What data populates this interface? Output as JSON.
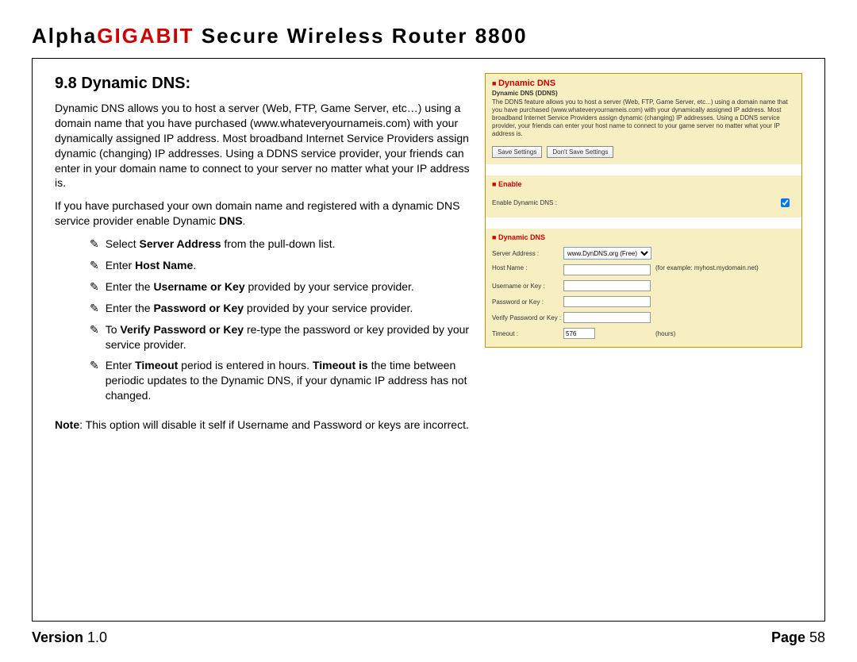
{
  "header": {
    "brand_prefix": "Alpha",
    "brand_red": "GIGABIT",
    "brand_rest": " Secure Wireless Router 8800"
  },
  "footer": {
    "version_label": "Version ",
    "version_value": "1.0",
    "page_label": "Page ",
    "page_number": "58"
  },
  "section": {
    "number_title": "9.8 Dynamic DNS:",
    "intro": "Dynamic DNS allows you to host a server (Web, FTP, Game Server, etc…) using a domain name that you have purchased (www.whateveryournameis.com) with your dynamically assigned IP address. Most broadband Internet Service Providers assign dynamic (changing) IP addresses. Using a DDNS service provider, your friends can enter in your domain name to connect to your server no matter what your IP address is.",
    "para2_a": "If you have purchased your own domain name and registered with a dynamic DNS service provider enable Dynamic ",
    "para2_b": "DNS",
    "para2_c": ".",
    "bullets": [
      {
        "pre": "Select ",
        "b": "Server Address",
        "post": "  from the pull-down list."
      },
      {
        "pre": "Enter ",
        "b": "Host Name",
        "post": "."
      },
      {
        "pre": "Enter the ",
        "b": "Username or Key",
        "post": " provided by your service provider."
      },
      {
        "pre": "Enter the ",
        "b": "Password or Key",
        "post": " provided by your service provider."
      },
      {
        "pre": "To ",
        "b": "Verify Password or Key",
        "post": " re-type the password or key provided by your service provider."
      },
      {
        "pre": "Enter ",
        "b": "Timeout",
        "post": " period is entered in hours. ",
        "b2": "Timeout is ",
        "post2": "the time between periodic  updates to the Dynamic DNS, if your dynamic IP address has not changed."
      }
    ],
    "note_label": "Note",
    "note_sep": ":   ",
    "note_text": "This option will disable it self if Username and Password or keys are incorrect."
  },
  "panel": {
    "title": "Dynamic DNS",
    "subtitle": "Dynamic DNS (DDNS)",
    "description": "The DDNS feature allows you to host a server (Web, FTP, Game Server, etc...) using a domain name that you have purchased (www.whateveryournameis.com) with your dynamically assigned IP address. Most broadband Internet Service Providers assign dynamic (changing) IP addresses. Using a DDNS service provider, your friends can enter your host name to connect to your game server no matter what your IP address is.",
    "save_btn": "Save Settings",
    "dont_save_btn": "Don't Save Settings",
    "enable_section": "Enable",
    "enable_label": "Enable Dynamic DNS :",
    "ddns_section": "Dynamic DNS",
    "server_address_label": "Server Address :",
    "server_address_value": "www.DynDNS.org (Free)",
    "host_name_label": "Host Name :",
    "host_name_value": "",
    "host_name_hint": "(for example: myhost.mydomain.net)",
    "username_label": "Username or Key :",
    "username_value": "",
    "password_label": "Password or Key :",
    "password_value": "",
    "verify_label": "Verify Password or Key :",
    "verify_value": "",
    "timeout_label": "Timeout :",
    "timeout_value": "576",
    "timeout_hint": "(hours)"
  }
}
